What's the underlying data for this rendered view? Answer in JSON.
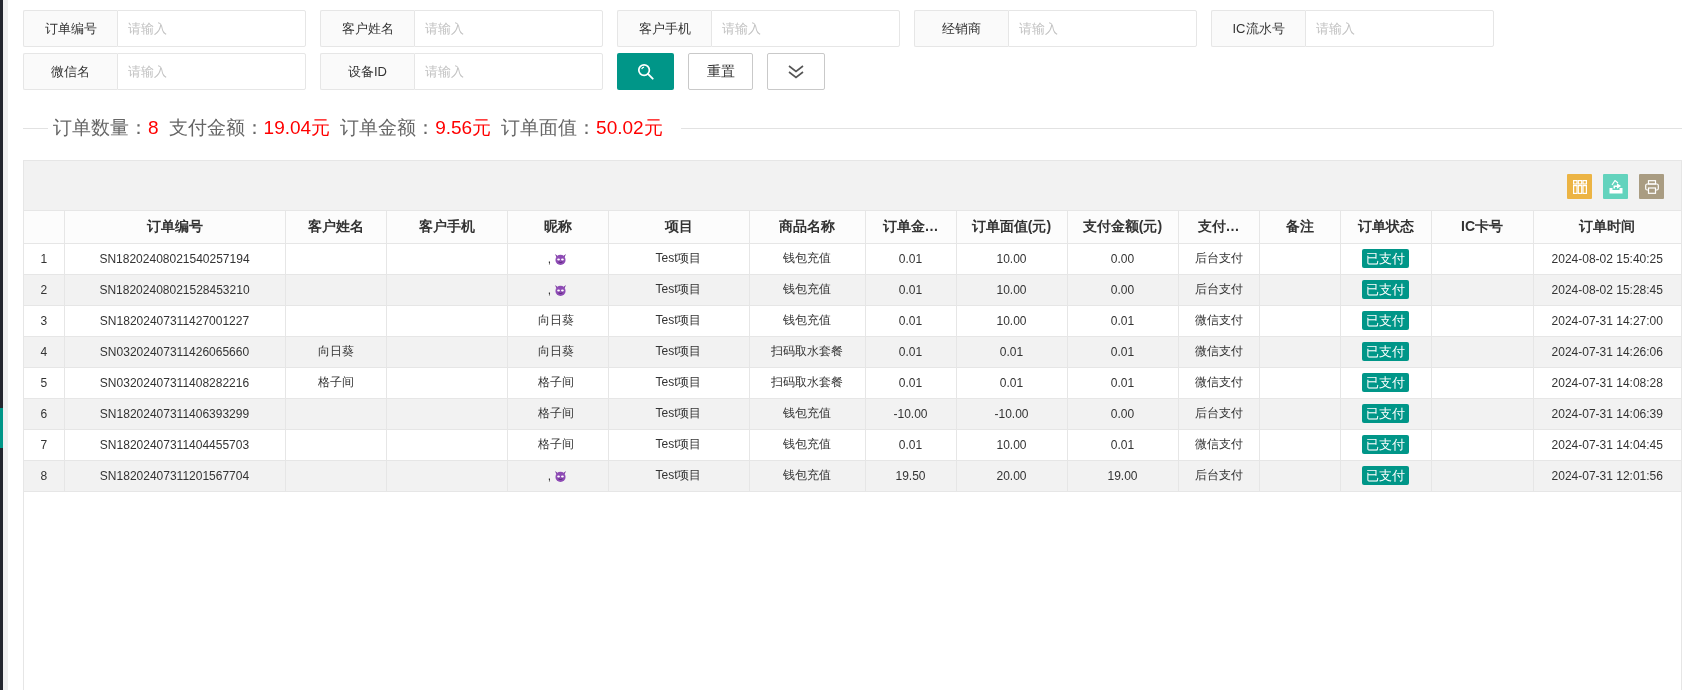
{
  "filters": [
    {
      "label": "订单编号",
      "placeholder": "请输入"
    },
    {
      "label": "客户姓名",
      "placeholder": "请输入"
    },
    {
      "label": "客户手机",
      "placeholder": "请输入"
    },
    {
      "label": "经销商",
      "placeholder": "请输入"
    },
    {
      "label": "IC流水号",
      "placeholder": "请输入"
    },
    {
      "label": "微信名",
      "placeholder": "请输入"
    },
    {
      "label": "设备ID",
      "placeholder": "请输入"
    }
  ],
  "actions": [
    {
      "kind": "search"
    },
    {
      "kind": "reset",
      "label": "重置"
    },
    {
      "kind": "expand"
    }
  ],
  "summary": [
    {
      "label": "订单数量：",
      "value": "8"
    },
    {
      "label": "支付金额：",
      "value": "19.04元"
    },
    {
      "label": "订单金额：",
      "value": "9.56元"
    },
    {
      "label": "订单面值：",
      "value": "50.02元"
    }
  ],
  "table": {
    "toolbar": [
      {
        "kind": "columns"
      },
      {
        "kind": "export"
      },
      {
        "kind": "print"
      }
    ],
    "columns": [
      "订单编号",
      "客户姓名",
      "客户手机",
      "昵称",
      "项目",
      "商品名称",
      "订单金…",
      "订单面值(元)",
      "支付金额(元)",
      "支付…",
      "备注",
      "订单状态",
      "IC卡号",
      "订单时间"
    ],
    "rows": [
      {
        "no": "1",
        "order_no": "SN18202408021540257194",
        "nickname": ",",
        "nickname_icon": true,
        "project": "Test项目",
        "product": "钱包充值",
        "order_amount": "0.01",
        "face_value": "10.00",
        "paid_amount": "0.00",
        "pay_method": "后台支付",
        "status": "已支付",
        "time": "2024-08-02 15:40:25"
      },
      {
        "no": "2",
        "order_no": "SN18202408021528453210",
        "nickname": ",",
        "nickname_icon": true,
        "project": "Test项目",
        "product": "钱包充值",
        "order_amount": "0.01",
        "face_value": "10.00",
        "paid_amount": "0.00",
        "pay_method": "后台支付",
        "status": "已支付",
        "time": "2024-08-02 15:28:45"
      },
      {
        "no": "3",
        "order_no": "SN18202407311427001227",
        "nickname": "向日葵",
        "nickname_icon": false,
        "project": "Test项目",
        "product": "钱包充值",
        "order_amount": "0.01",
        "face_value": "10.00",
        "paid_amount": "0.01",
        "pay_method": "微信支付",
        "status": "已支付",
        "time": "2024-07-31 14:27:00"
      },
      {
        "no": "4",
        "order_no": "SN03202407311426065660",
        "customer_name": "向日葵",
        "nickname": "向日葵",
        "nickname_icon": false,
        "project": "Test项目",
        "product": "扫码取水套餐",
        "order_amount": "0.01",
        "face_value": "0.01",
        "paid_amount": "0.01",
        "pay_method": "微信支付",
        "status": "已支付",
        "time": "2024-07-31 14:26:06"
      },
      {
        "no": "5",
        "order_no": "SN03202407311408282216",
        "customer_name": "格子间",
        "nickname": "格子间",
        "nickname_icon": false,
        "project": "Test项目",
        "product": "扫码取水套餐",
        "order_amount": "0.01",
        "face_value": "0.01",
        "paid_amount": "0.01",
        "pay_method": "微信支付",
        "status": "已支付",
        "time": "2024-07-31 14:08:28"
      },
      {
        "no": "6",
        "order_no": "SN18202407311406393299",
        "nickname": "格子间",
        "nickname_icon": false,
        "project": "Test项目",
        "product": "钱包充值",
        "order_amount": "-10.00",
        "face_value": "-10.00",
        "paid_amount": "0.00",
        "pay_method": "后台支付",
        "status": "已支付",
        "time": "2024-07-31 14:06:39"
      },
      {
        "no": "7",
        "order_no": "SN18202407311404455703",
        "nickname": "格子间",
        "nickname_icon": false,
        "project": "Test项目",
        "product": "钱包充值",
        "order_amount": "0.01",
        "face_value": "10.00",
        "paid_amount": "0.01",
        "pay_method": "微信支付",
        "status": "已支付",
        "time": "2024-07-31 14:04:45"
      },
      {
        "no": "8",
        "order_no": "SN18202407311201567704",
        "nickname": ",",
        "nickname_icon": true,
        "project": "Test项目",
        "product": "钱包充值",
        "order_amount": "19.50",
        "face_value": "20.00",
        "paid_amount": "19.00",
        "pay_method": "后台支付",
        "status": "已支付",
        "time": "2024-07-31 12:01:56"
      }
    ]
  }
}
